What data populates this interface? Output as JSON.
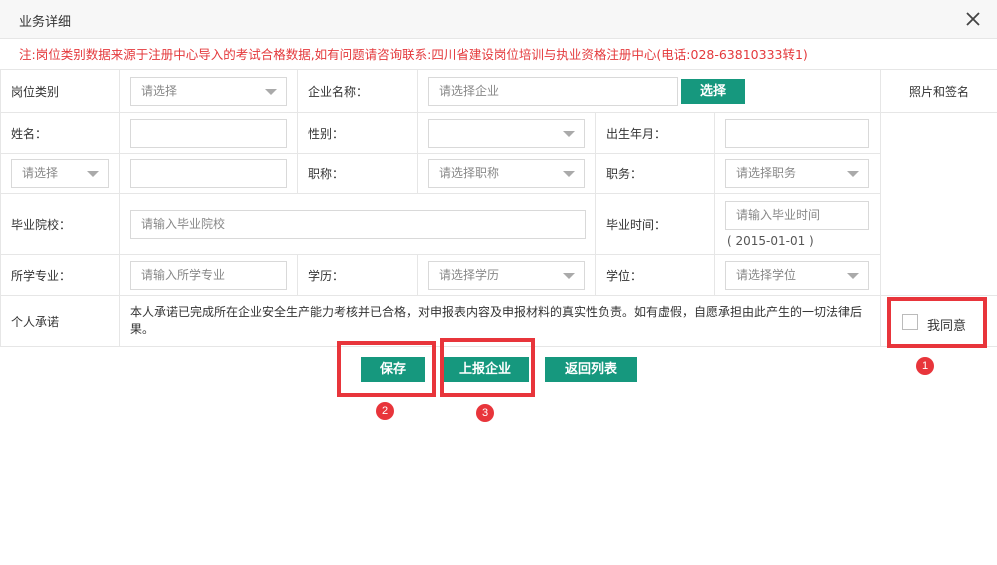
{
  "dialog": {
    "title": "业务详细",
    "notice": "注:岗位类别数据来源于注册中心导入的考试合格数据,如有问题请咨询联系:四川省建设岗位培训与执业资格注册中心(电话:028-63810333转1)"
  },
  "form": {
    "position_type": {
      "label": "岗位类别",
      "placeholder": "请选择"
    },
    "company": {
      "label": "企业名称：",
      "placeholder": "请选择企业",
      "select_button": "选择"
    },
    "photo": {
      "label": "照片和签名"
    },
    "name": {
      "label": "姓名：",
      "value": ""
    },
    "gender": {
      "label": "性别：",
      "value": ""
    },
    "birth": {
      "label": "出生年月：",
      "value": ""
    },
    "id_type": {
      "placeholder": "请选择",
      "value": ""
    },
    "title_rank": {
      "label": "职称：",
      "placeholder": "请选择职称"
    },
    "duty": {
      "label": "职务：",
      "placeholder": "请选择职务"
    },
    "school": {
      "label": "毕业院校：",
      "placeholder": "请输入毕业院校"
    },
    "grad_time": {
      "label": "毕业时间：",
      "placeholder": "请输入毕业时间",
      "hint": "( 2015-01-01 )"
    },
    "major": {
      "label": "所学专业：",
      "placeholder": "请输入所学专业"
    },
    "education": {
      "label": "学历：",
      "placeholder": "请选择学历"
    },
    "degree": {
      "label": "学位：",
      "placeholder": "请选择学位"
    },
    "promise": {
      "label": "个人承诺",
      "text": "本人承诺已完成所在企业安全生产能力考核并已合格，对申报表内容及申报材料的真实性负责。如有虚假，自愿承担由此产生的一切法律后果。",
      "agree_label": "我同意"
    }
  },
  "actions": {
    "save": "保存",
    "report": "上报企业",
    "back": "返回列表"
  },
  "annotations": {
    "badges": [
      "1",
      "2",
      "3"
    ],
    "color": "#e8353b"
  },
  "colors": {
    "primary_button": "#16987e",
    "notice_text": "#e4393c"
  }
}
